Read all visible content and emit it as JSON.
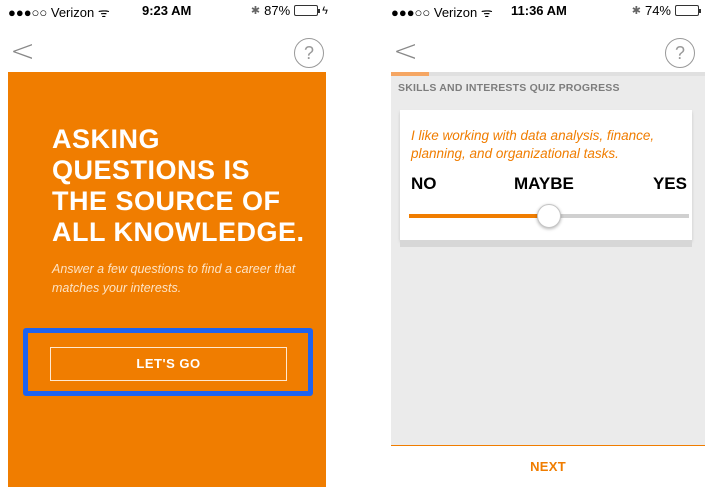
{
  "left_phone": {
    "status": {
      "carrier": "●●●○○ Verizon ᯤ",
      "time": "9:23 AM",
      "bluetooth": "✱",
      "battery": "87%",
      "battery_level": 0.87,
      "battery_color": "#4cd964",
      "charge": "ϟ"
    },
    "nav": {
      "back": "<",
      "help": "?"
    },
    "headline_lines": [
      "ASKING",
      "QUESTIONS IS",
      "THE SOURCE OF",
      "ALL KNOWLEDGE."
    ],
    "subtitle": "Answer a few questions to find a career that matches your interests.",
    "cta_label": "LET'S GO",
    "highlight_color": "#1e63f0"
  },
  "right_phone": {
    "status": {
      "carrier": "●●●○○ Verizon ᯤ",
      "time": "11:36 AM",
      "bluetooth": "✱",
      "battery": "74%",
      "battery_level": 0.74,
      "battery_color": "#000000"
    },
    "nav": {
      "back": "<",
      "help": "?"
    },
    "progress_label": "SKILLS AND INTERESTS QUIZ PROGRESS",
    "progress_value": 0.12,
    "question": "I like working with data analysis, finance, planning, and organizational tasks.",
    "choices": {
      "no": "NO",
      "maybe": "MAYBE",
      "yes": "YES"
    },
    "slider_value": 0.5,
    "next_label": "NEXT"
  },
  "colors": {
    "accent": "#f07d00",
    "card_background": "#ebebeb"
  }
}
